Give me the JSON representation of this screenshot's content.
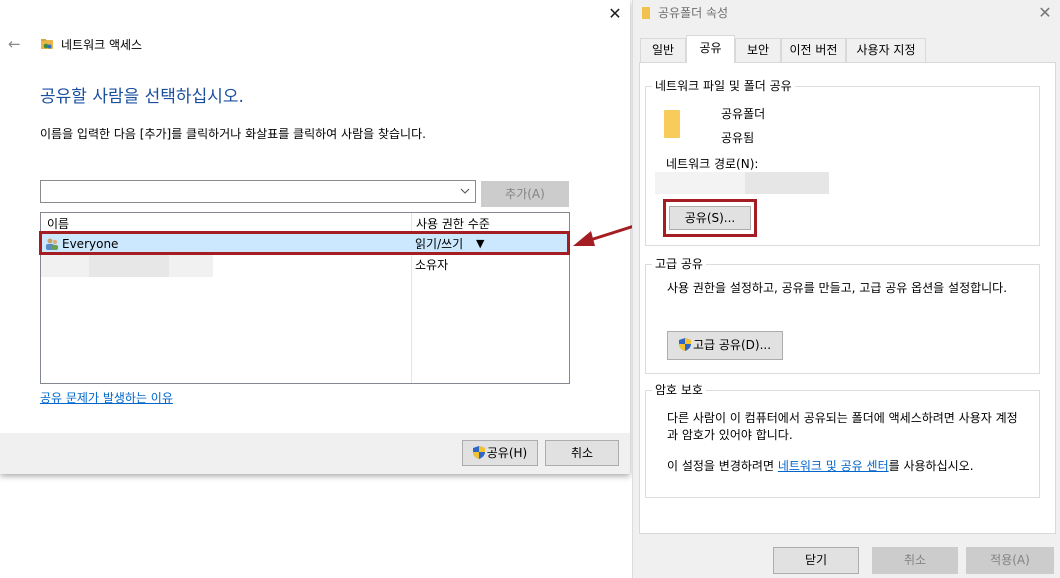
{
  "network_access": {
    "close_glyph": "✕",
    "back_glyph": "←",
    "title": "네트워크 액세스",
    "heading": "공유할 사람을 선택하십시오.",
    "instruction": "이름을 입력한 다음 [추가]를 클릭하거나 화살표를 클릭하여 사람을 찾습니다.",
    "name_input_value": "",
    "add_button": "추가(A)",
    "columns": [
      "이름",
      "사용 권한 수준"
    ],
    "rows": [
      {
        "name": "Everyone",
        "permission": "읽기/쓰기",
        "dropdown_glyph": "▼"
      },
      {
        "name": "",
        "permission": "소유자"
      }
    ],
    "help_link": "공유 문제가 발생하는 이유",
    "share_button": "공유(H)",
    "cancel_button": "취소"
  },
  "properties": {
    "title": "공유폴더 속성",
    "close_glyph": "✕",
    "tabs": [
      "일반",
      "공유",
      "보안",
      "이전 버전",
      "사용자 지정"
    ],
    "active_tab": "공유",
    "network_share": {
      "group_title": "네트워크 파일 및 폴더 공유",
      "folder_name": "공유폴더",
      "folder_status": "공유됨",
      "network_path_label": "네트워크 경로(N):",
      "share_button": "공유(S)..."
    },
    "advanced_share": {
      "group_title": "고급 공유",
      "description": "사용 권한을 설정하고, 공유를 만들고, 고급 공유 옵션을 설정합니다.",
      "button": "고급 공유(D)..."
    },
    "password_protection": {
      "group_title": "암호 보호",
      "description": "다른 사람이 이 컴퓨터에서 공유되는 폴더에 액세스하려면 사용자 계정과 암호가 있어야 합니다.",
      "change_prefix": "이 설정을 변경하려면 ",
      "link": "네트워크 및 공유 센터",
      "change_suffix": "를 사용하십시오."
    },
    "footer": {
      "close": "닫기",
      "cancel": "취소",
      "apply": "적용(A)"
    }
  },
  "colors": {
    "highlight": "#a31d22",
    "heading_blue": "#1a4fa0",
    "link": "#0066cc",
    "selection": "#cce8ff"
  }
}
